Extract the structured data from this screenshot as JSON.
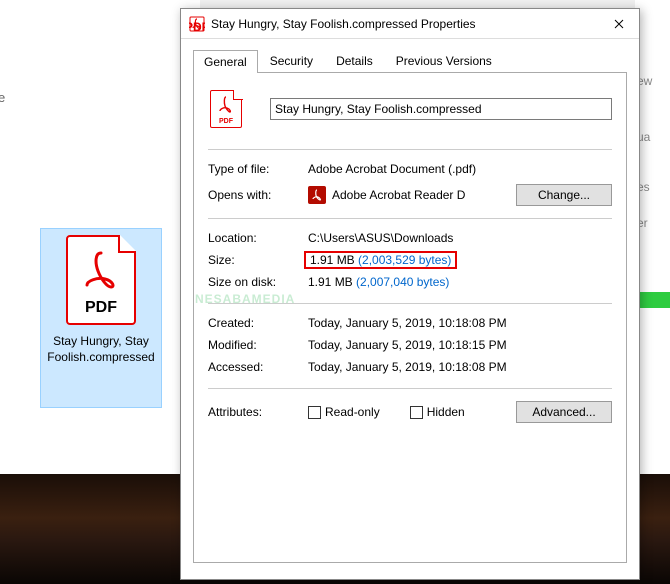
{
  "desktop": {
    "file_caption": "Stay Hungry, Stay Foolish.compressed",
    "cut_text": "e"
  },
  "watermark": {
    "text": "NESABAMEDIA"
  },
  "right_strip": {
    "t1": "ew",
    "t2": "ua",
    "t3": "es",
    "t4": "er"
  },
  "dialog": {
    "title": "Stay Hungry, Stay Foolish.compressed Properties",
    "tabs": {
      "general": "General",
      "security": "Security",
      "details": "Details",
      "previous": "Previous Versions"
    },
    "filename_value": "Stay Hungry, Stay Foolish.compressed",
    "type_lbl": "Type of file:",
    "type_val": "Adobe Acrobat Document (.pdf)",
    "opens_lbl": "Opens with:",
    "opens_val": "Adobe Acrobat Reader D",
    "change_btn": "Change...",
    "location_lbl": "Location:",
    "location_val": "C:\\Users\\ASUS\\Downloads",
    "size_lbl": "Size:",
    "size_val_pre": "1.91 MB ",
    "size_val_link": "(2,003,529 bytes)",
    "disk_lbl": "Size on disk:",
    "disk_val_pre": "1.91 MB ",
    "disk_val_link": "(2,007,040 bytes)",
    "created_lbl": "Created:",
    "created_val": "Today, January 5, 2019, 10:18:08 PM",
    "modified_lbl": "Modified:",
    "modified_val": "Today, January 5, 2019, 10:18:15 PM",
    "accessed_lbl": "Accessed:",
    "accessed_val": "Today, January 5, 2019, 10:18:08 PM",
    "attr_lbl": "Attributes:",
    "readonly_lbl": "Read-only",
    "hidden_lbl": "Hidden",
    "advanced_btn": "Advanced..."
  },
  "icons": {
    "pdf_label": "PDF"
  }
}
